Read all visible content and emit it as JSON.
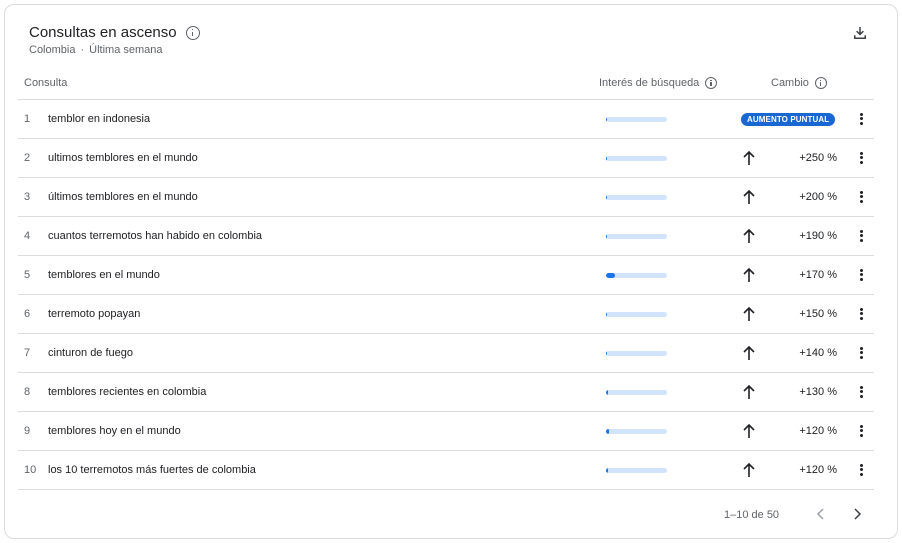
{
  "header": {
    "title": "Consultas en ascenso",
    "location": "Colombia",
    "separator": "·",
    "period": "Última semana"
  },
  "columns": {
    "query": "Consulta",
    "interest": "Interés de búsqueda",
    "change": "Cambio"
  },
  "rows": [
    {
      "rank": "1",
      "query": "temblor en indonesia",
      "interest": 0.02,
      "change": "AUMENTO PUNTUAL",
      "badge": true
    },
    {
      "rank": "2",
      "query": "ultimos temblores en el mundo",
      "interest": 0.02,
      "change": "+250 %"
    },
    {
      "rank": "3",
      "query": "últimos temblores en el mundo",
      "interest": 0.02,
      "change": "+200 %"
    },
    {
      "rank": "4",
      "query": "cuantos terremotos han habido en colombia",
      "interest": 0.02,
      "change": "+190 %"
    },
    {
      "rank": "5",
      "query": "temblores en el mundo",
      "interest": 0.14,
      "change": "+170 %"
    },
    {
      "rank": "6",
      "query": "terremoto popayan",
      "interest": 0.02,
      "change": "+150 %"
    },
    {
      "rank": "7",
      "query": "cinturon de fuego",
      "interest": 0.02,
      "change": "+140 %"
    },
    {
      "rank": "8",
      "query": "temblores recientes en colombia",
      "interest": 0.04,
      "change": "+130 %"
    },
    {
      "rank": "9",
      "query": "temblores hoy en el mundo",
      "interest": 0.05,
      "change": "+120 %"
    },
    {
      "rank": "10",
      "query": "los 10 terremotos más fuertes de colombia",
      "interest": 0.03,
      "change": "+120 %"
    }
  ],
  "pagination": {
    "label": "1–10 de 50"
  },
  "icons": {
    "title_info": "info-icon",
    "download": "download-icon",
    "row_arrow": "arrow-up-icon",
    "row_menu": "more-vert-icon",
    "prev": "chevron-left-icon",
    "next": "chevron-right-icon"
  },
  "colors": {
    "accent": "#1a73e8",
    "bar_track": "#d2e3fc",
    "badge": "#1967d2",
    "divider": "#dadce0"
  }
}
